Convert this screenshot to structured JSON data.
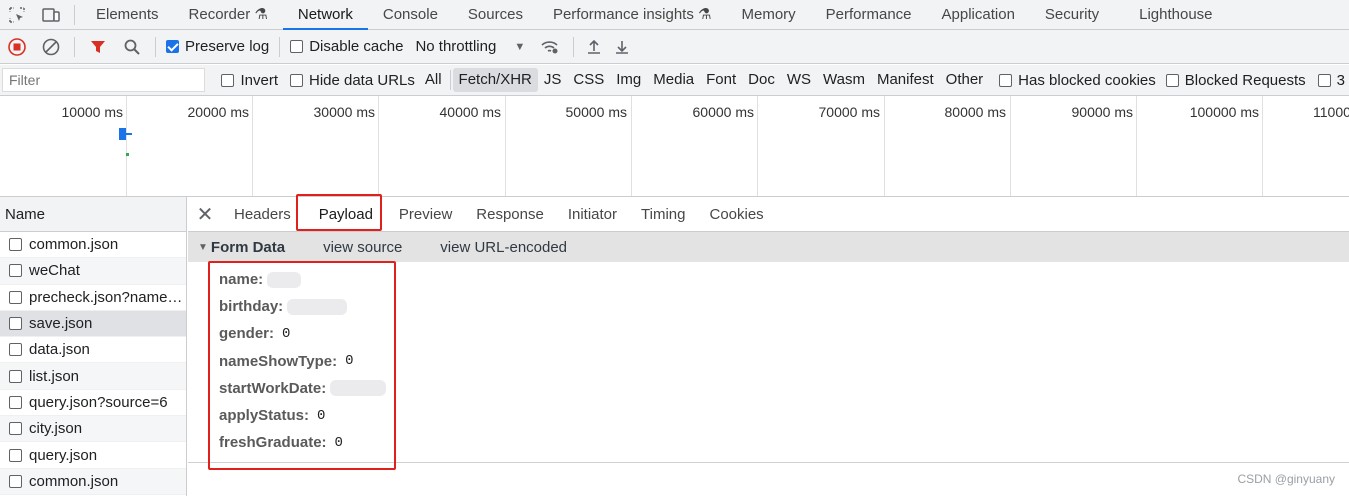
{
  "top_tabs": [
    "Elements",
    "Recorder",
    "Network",
    "Console",
    "Sources",
    "Performance insights",
    "Memory",
    "Performance",
    "Application",
    "Security",
    "Lighthouse"
  ],
  "toolbar": {
    "preserve_log": "Preserve log",
    "disable_cache": "Disable cache",
    "throttling": "No throttling"
  },
  "filter": {
    "placeholder": "Filter",
    "invert": "Invert",
    "hide_data_urls": "Hide data URLs",
    "types": [
      "All",
      "Fetch/XHR",
      "JS",
      "CSS",
      "Img",
      "Media",
      "Font",
      "Doc",
      "WS",
      "Wasm",
      "Manifest",
      "Other"
    ],
    "has_blocked_cookies": "Has blocked cookies",
    "blocked_requests": "Blocked Requests",
    "third_party": "3"
  },
  "timeline": {
    "ticks": [
      "10000 ms",
      "20000 ms",
      "30000 ms",
      "40000 ms",
      "50000 ms",
      "60000 ms",
      "70000 ms",
      "80000 ms",
      "90000 ms",
      "100000 ms",
      "11000"
    ]
  },
  "requests": {
    "header": "Name",
    "items": [
      "common.json",
      "weChat",
      "precheck.json?name…",
      "save.json",
      "data.json",
      "list.json",
      "query.json?source=6",
      "city.json",
      "query.json",
      "common.json"
    ]
  },
  "detail_tabs": [
    "Headers",
    "Payload",
    "Preview",
    "Response",
    "Initiator",
    "Timing",
    "Cookies"
  ],
  "form_data": {
    "title": "Form Data",
    "view_source": "view source",
    "view_url_encoded": "view URL-encoded",
    "fields": [
      {
        "name": "name:",
        "value": ""
      },
      {
        "name": "birthday:",
        "value": ""
      },
      {
        "name": "gender:",
        "value": "0"
      },
      {
        "name": "nameShowType:",
        "value": "0"
      },
      {
        "name": "startWorkDate:",
        "value": ""
      },
      {
        "name": "applyStatus:",
        "value": "0"
      },
      {
        "name": "freshGraduate:",
        "value": "0"
      }
    ]
  },
  "watermark": "CSDN @ginyuany",
  "colors": {
    "accent": "#1a73e8",
    "highlight": "#e0201a",
    "record": "#d93025"
  }
}
